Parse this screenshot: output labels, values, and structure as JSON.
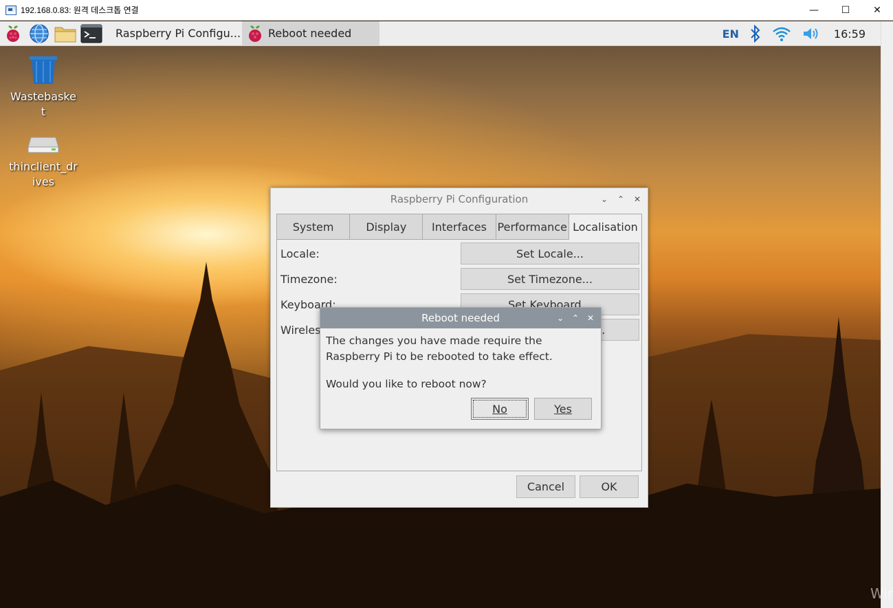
{
  "rdp": {
    "title": "192.168.0.83: 원격 데스크톱 연결",
    "minimize": "—",
    "maximize": "☐",
    "close": "✕"
  },
  "taskbar": {
    "tasks": [
      {
        "label": "Raspberry Pi Configu...",
        "icon": "raspberry-icon",
        "active": false
      },
      {
        "label": "Reboot needed",
        "icon": "raspberry-icon",
        "active": true
      }
    ],
    "tray": {
      "language": "EN",
      "clock": "16:59"
    }
  },
  "desktop": {
    "icons": [
      {
        "label": "Wastebasket",
        "icon": "wastebasket-icon"
      },
      {
        "label": "thinclient_drives",
        "icon": "drive-icon"
      }
    ]
  },
  "config_window": {
    "title": "Raspberry Pi Configuration",
    "tabs": [
      "System",
      "Display",
      "Interfaces",
      "Performance",
      "Localisation"
    ],
    "active_tab": "Localisation",
    "rows": [
      {
        "label": "Locale:",
        "button": "Set Locale..."
      },
      {
        "label": "Timezone:",
        "button": "Set Timezone..."
      },
      {
        "label": "Keyboard:",
        "button": "Set Keyboard..."
      },
      {
        "label": "Wireless LAN Country:",
        "button": "Set WLAN Country..."
      }
    ],
    "cancel_label": "Cancel",
    "ok_label": "OK"
  },
  "reboot_dialog": {
    "title": "Reboot needed",
    "message": "The changes you have made require the Raspberry Pi to be rebooted to take effect.",
    "question": "Would you like to reboot now?",
    "no_label": "No",
    "yes_label": "Yes"
  },
  "watermark": "Win"
}
